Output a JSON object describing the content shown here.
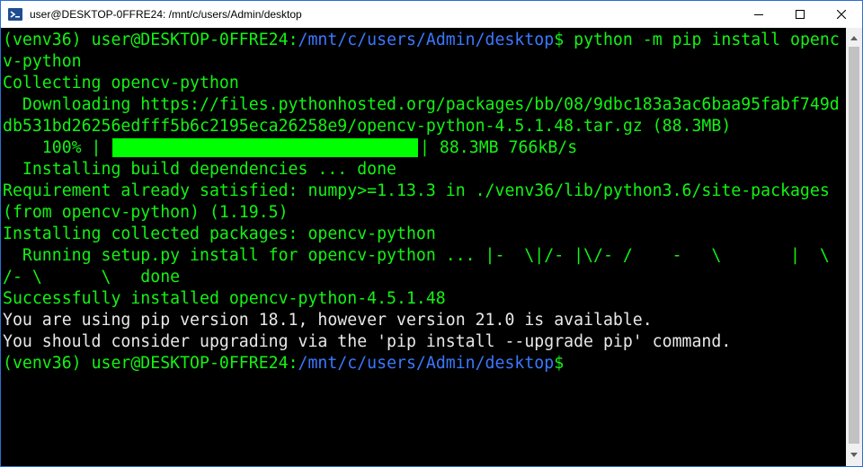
{
  "window": {
    "title": "user@DESKTOP-0FFRE24: /mnt/c/users/Admin/desktop"
  },
  "terminal": {
    "prompt": {
      "env": "(venv36) ",
      "user_host": "user@DESKTOP-0FFRE24",
      "colon": ":",
      "path": "/mnt/c/users/Admin/desktop",
      "dollar": "$"
    },
    "command_part1": " python -m pip install openc",
    "command_part2": "v-python",
    "lines": {
      "collecting": "Collecting opencv-python",
      "downloading_1": "  Downloading https://files.pythonhosted.org/packages/bb/08/9dbc183a3ac6baa95fabf749d",
      "downloading_2": "db531bd26256edfff5b6c2195eca26258e9/opencv-python-4.5.1.48.tar.gz (88.3MB)",
      "progress_percent": "    100% |",
      "progress_end": "| 88.3MB 766kB/s",
      "build_deps": "  Installing build dependencies ... done",
      "req_1": "Requirement already satisfied: numpy>=1.13.3 in ./venv36/lib/python3.6/site-packages",
      "req_2": "(from opencv-python) (1.19.5)",
      "installing": "Installing collected packages: opencv-python",
      "running_1": "  Running setup.py install for opencv-python ... |-  \\|/- |\\/- /    -   \\       |  \\",
      "running_2": "/- \\      \\   done",
      "success": "Successfully installed opencv-python-4.5.1.48",
      "pip_version": "You are using pip version 18.1, however version 21.0 is available.",
      "pip_upgrade": "You should consider upgrading via the 'pip install --upgrade pip' command."
    },
    "progress_fraction": 1.0
  },
  "colors": {
    "terminal_bg": "#000000",
    "green_text": "#13f313",
    "path_blue": "#3b78ff",
    "white_text": "#e8e8e8",
    "progress_fill": "#00ff00"
  },
  "icons": {
    "app": "terminal-icon",
    "minimize": "minimize-icon",
    "maximize": "maximize-icon",
    "close": "close-icon",
    "scroll_up": "chevron-up-icon",
    "scroll_down": "chevron-down-icon"
  }
}
